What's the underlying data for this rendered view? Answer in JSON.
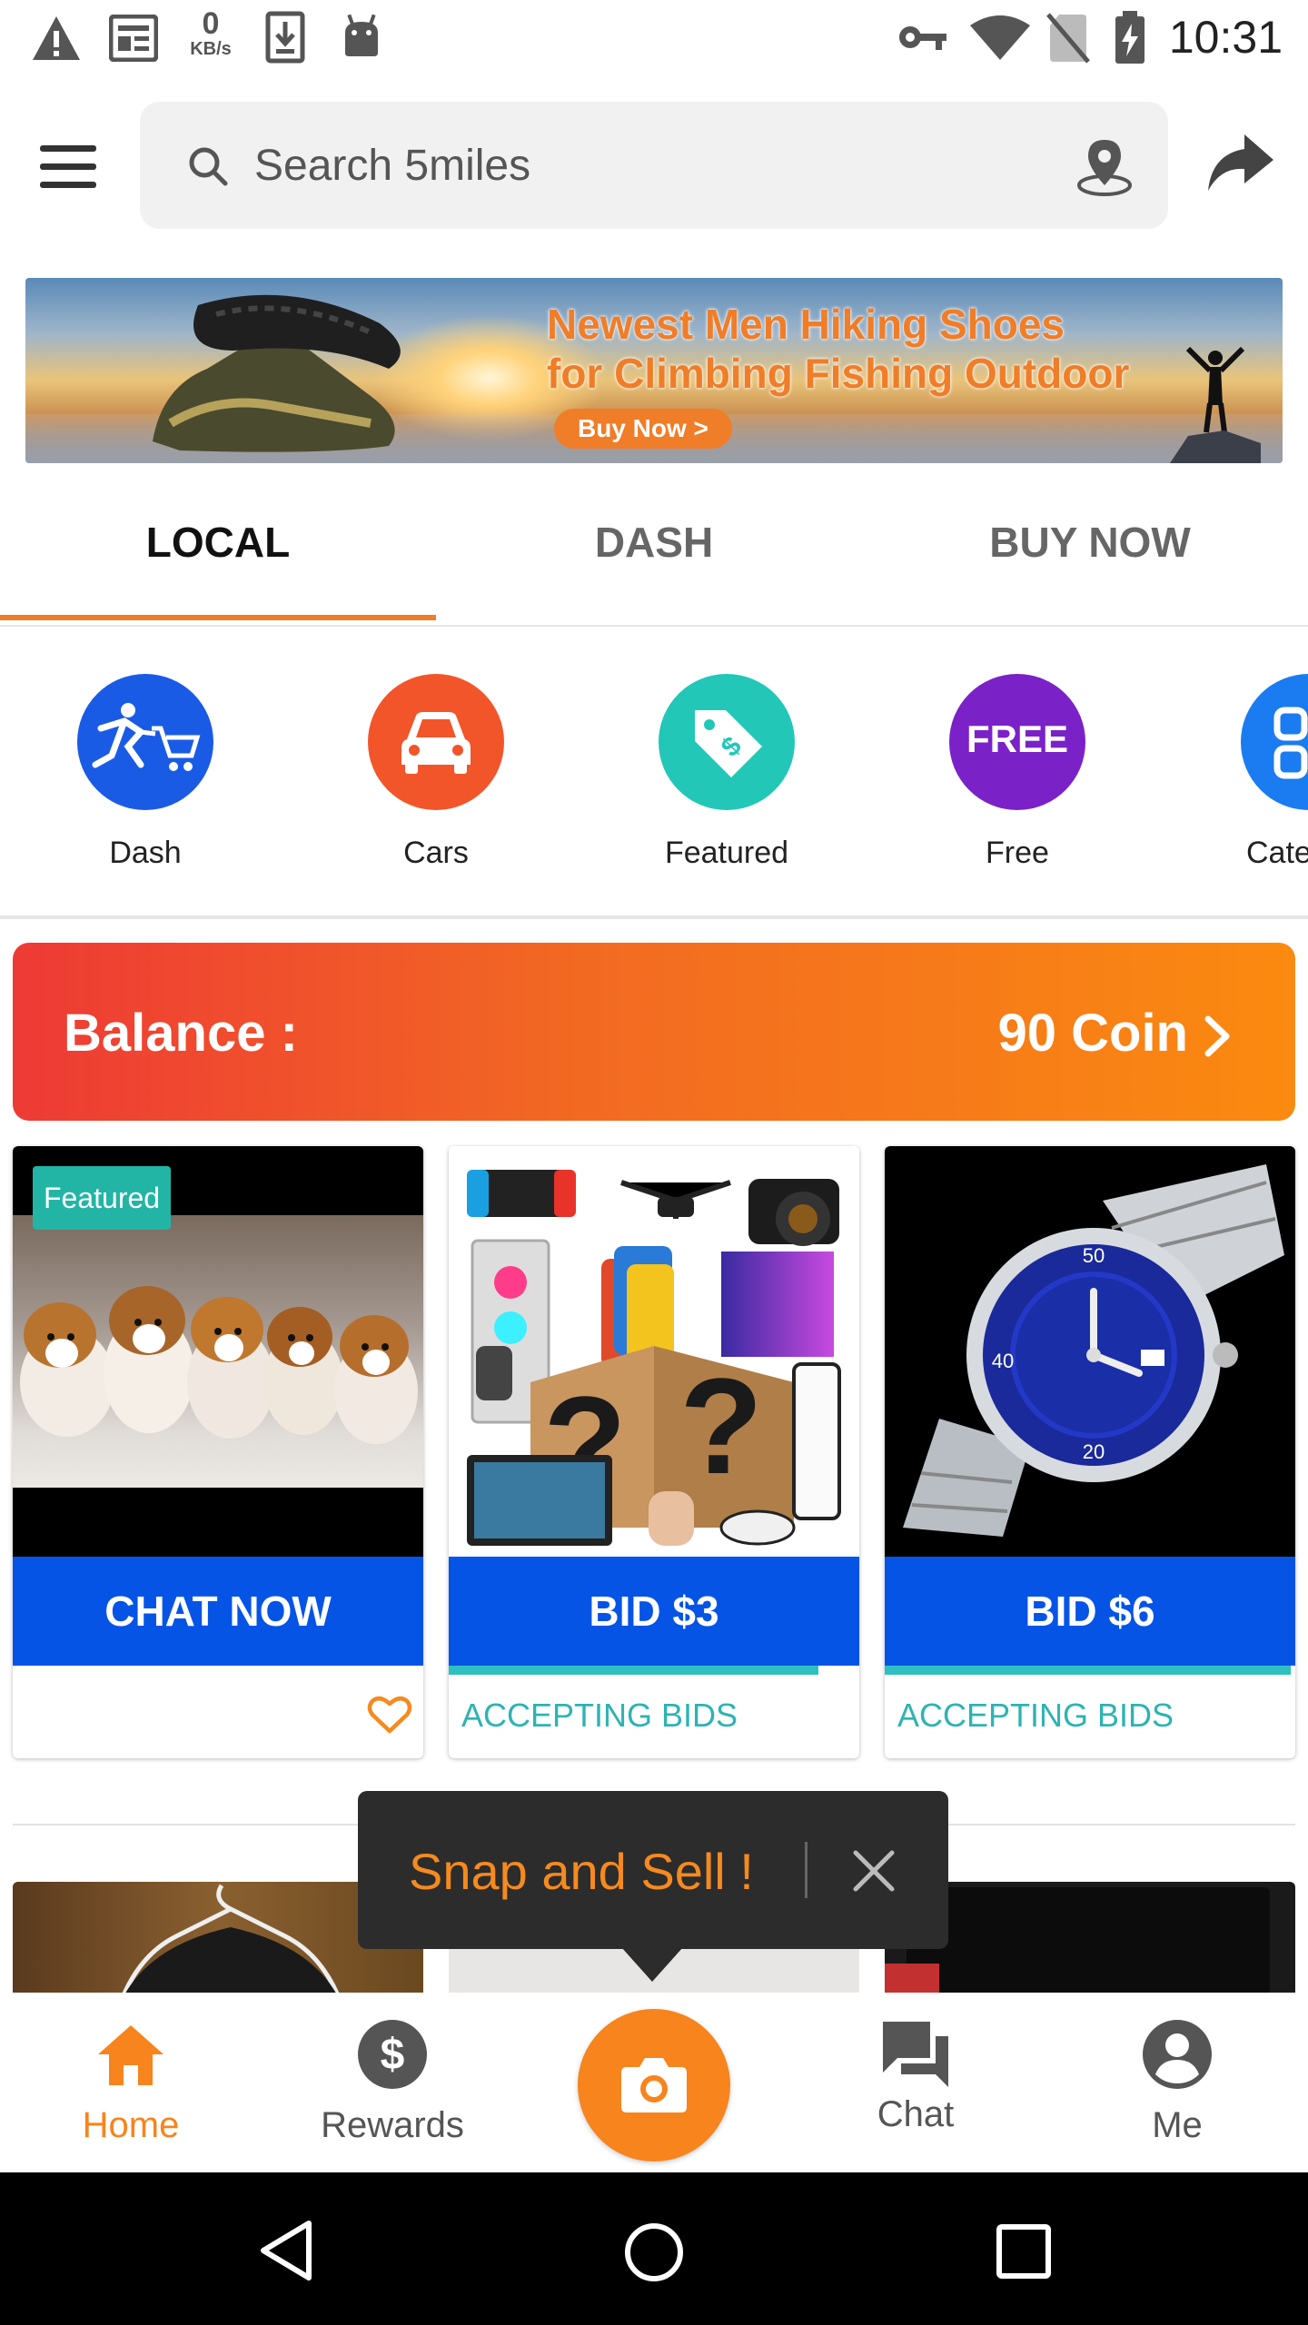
{
  "status_bar": {
    "time": "10:31",
    "net_speed_value": "0",
    "net_speed_unit": "KB/s",
    "icons": [
      "warning-icon",
      "news-icon",
      "download-icon",
      "android-icon",
      "key-icon",
      "wifi-icon",
      "no-sim-icon",
      "battery-charging-icon"
    ]
  },
  "search": {
    "placeholder": "Search 5miles"
  },
  "banner": {
    "title_line1": "Newest Men Hiking Shoes",
    "title_line2": "for Climbing Fishing Outdoor",
    "cta": "Buy Now >"
  },
  "tabs": [
    {
      "label": "LOCAL",
      "active": true
    },
    {
      "label": "DASH",
      "active": false
    },
    {
      "label": "BUY NOW",
      "active": false
    }
  ],
  "categories": [
    {
      "label": "Dash",
      "color": "#1a5be6",
      "icon": "dash-cart-icon"
    },
    {
      "label": "Cars",
      "color": "#f2552a",
      "icon": "car-icon"
    },
    {
      "label": "Featured",
      "color": "#22c7b8",
      "icon": "price-tag-icon"
    },
    {
      "label": "Free",
      "color": "#7a22c8",
      "icon": "free-icon",
      "icon_text": "FREE"
    },
    {
      "label": "Categories",
      "color": "#1a7cf0",
      "icon": "categories-icon"
    }
  ],
  "balance": {
    "label": "Balance :",
    "value": "90 Coin"
  },
  "products": [
    {
      "badge": "Featured",
      "cta": "CHAT NOW",
      "status": "",
      "image": "puppies-photo"
    },
    {
      "badge": "",
      "cta": "BID $3",
      "status": "ACCEPTING BIDS",
      "progress": 0.9,
      "image": "mystery-box-electronics-photo"
    },
    {
      "badge": "",
      "cta": "BID $6",
      "status": "ACCEPTING BIDS",
      "progress": 0.99,
      "image": "blue-watch-photo"
    }
  ],
  "tooltip": {
    "text": "Snap and Sell !"
  },
  "bottom_nav": [
    {
      "label": "Home",
      "active": true,
      "icon": "home-icon"
    },
    {
      "label": "Rewards",
      "active": false,
      "icon": "dollar-icon"
    },
    {
      "label": "",
      "active": false,
      "icon": "camera-icon"
    },
    {
      "label": "Chat",
      "active": false,
      "icon": "chat-icon"
    },
    {
      "label": "Me",
      "active": false,
      "icon": "account-icon"
    }
  ],
  "colors": {
    "accent": "#f7841c",
    "cta_blue": "#0554e6",
    "teal": "#2eb3b3"
  }
}
